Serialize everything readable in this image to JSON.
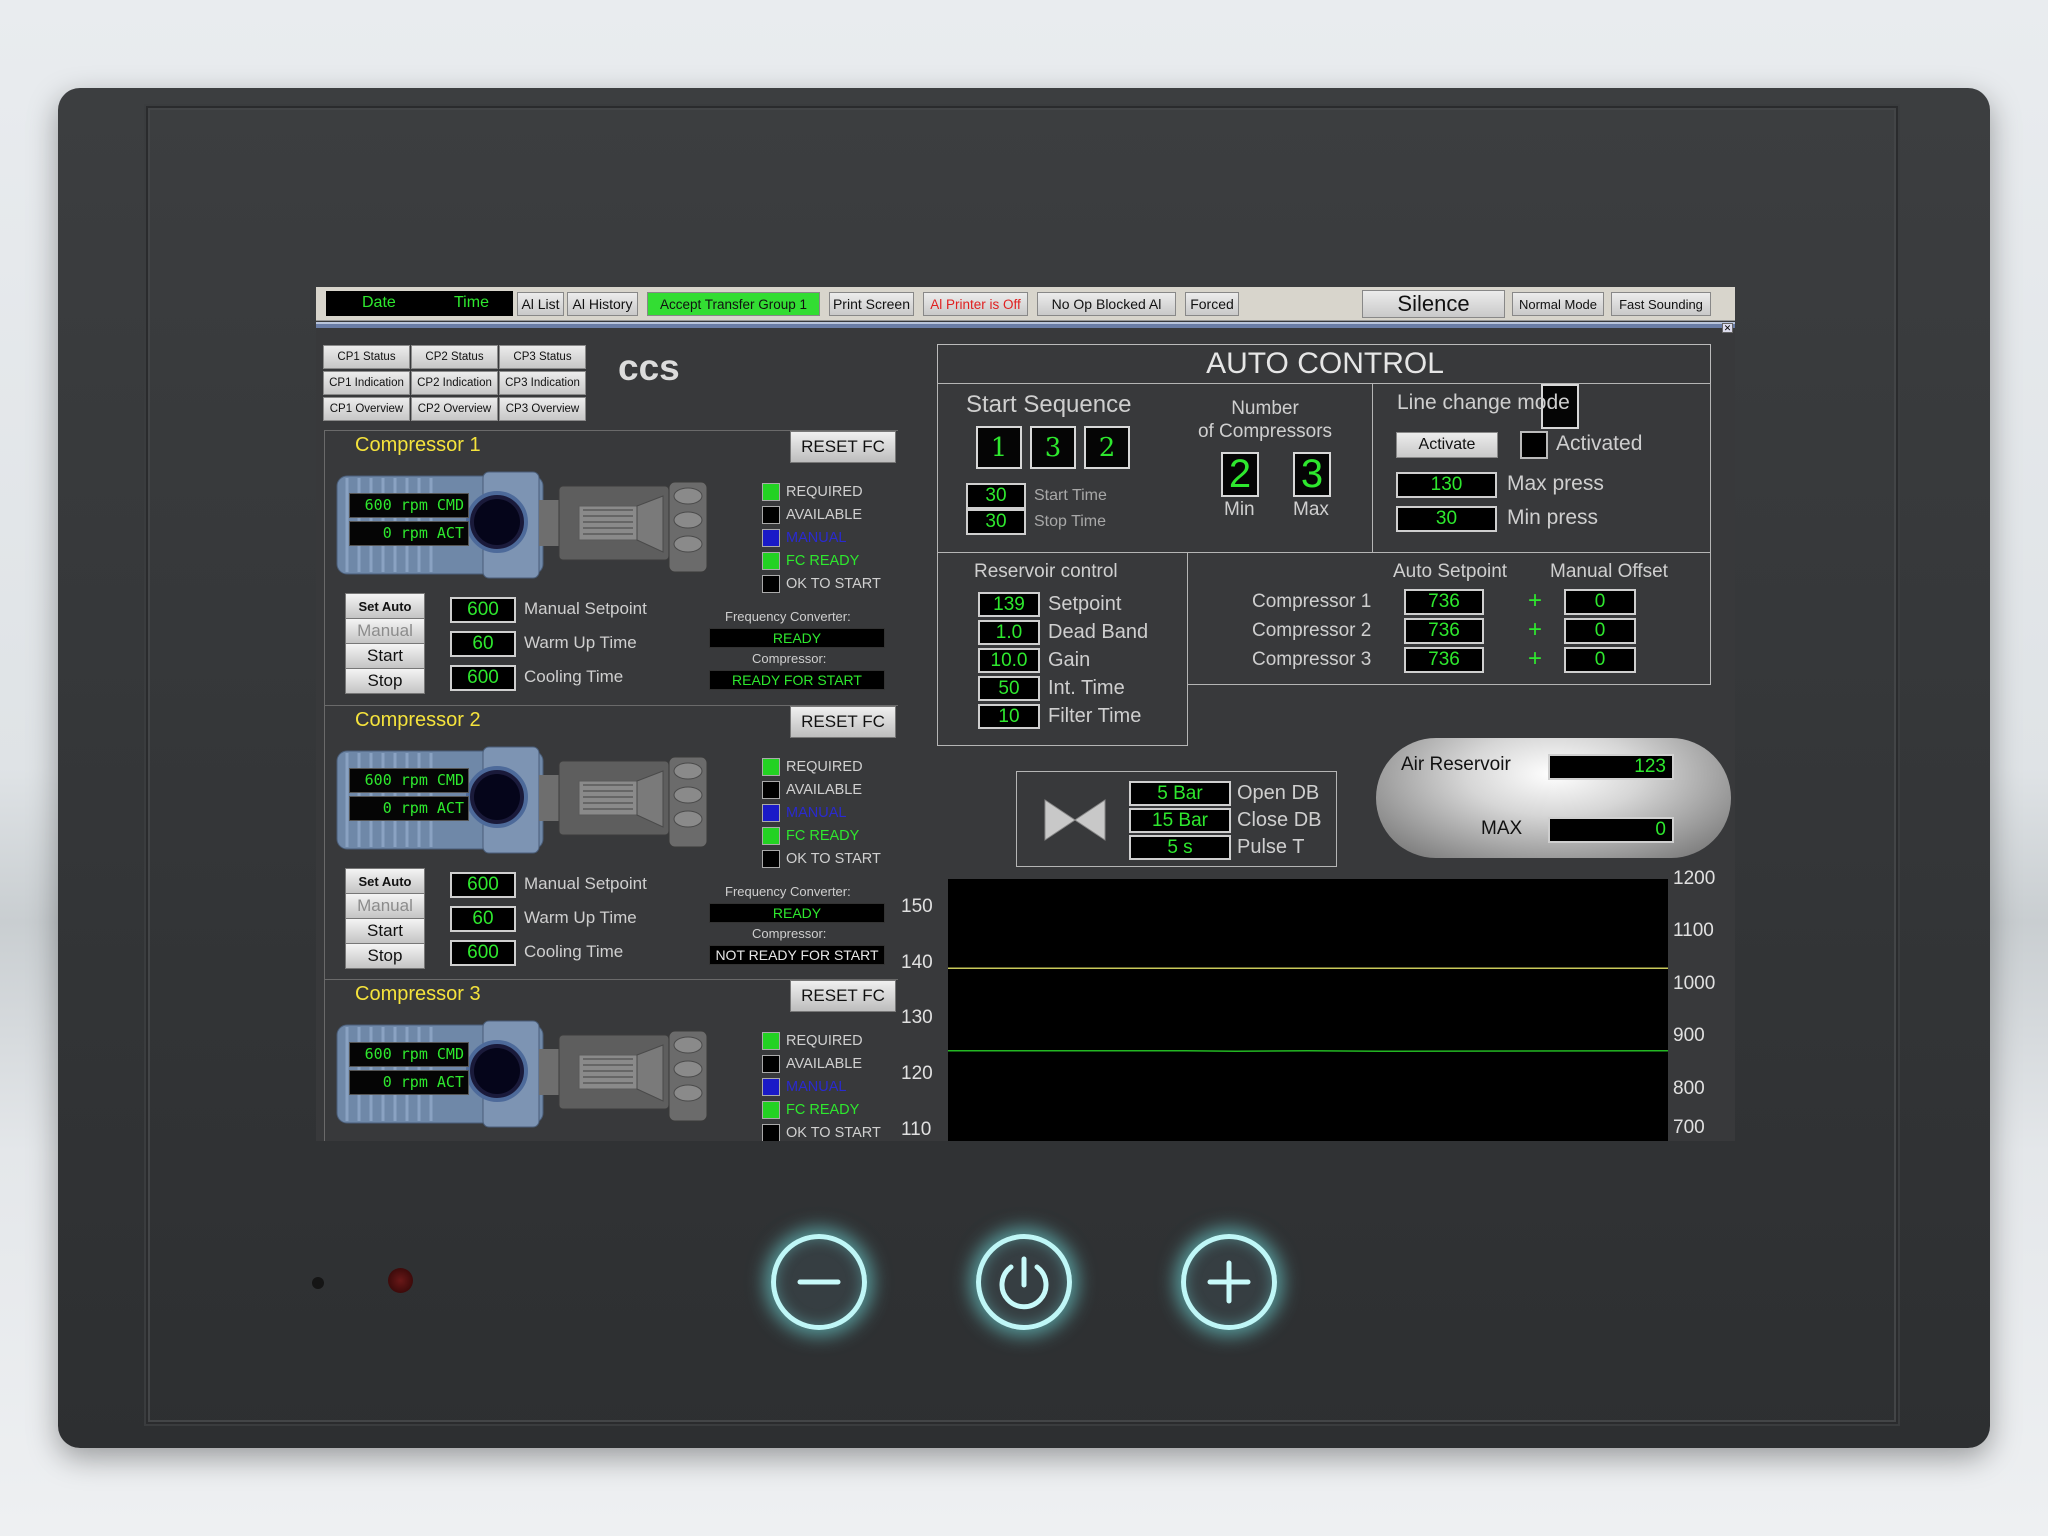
{
  "topbar": {
    "date_label": "Date",
    "time_label": "Time",
    "buttons": [
      {
        "label": "Al List"
      },
      {
        "label": "Al History"
      },
      {
        "label": "Accept Transfer Group 1",
        "bg": "#33dd33"
      },
      {
        "label": "Print Screen"
      },
      {
        "label": "Al Printer is Off",
        "color": "#e02020"
      },
      {
        "label": "No Op Blocked Al"
      },
      {
        "label": "Forced"
      }
    ],
    "silence_label": "Silence",
    "normal_mode_label": "Normal Mode",
    "fast_sounding_label": "Fast Sounding",
    "close_glyph": "✕"
  },
  "cp_buttons": [
    [
      "CP1 Status",
      "CP2 Status",
      "CP3 Status"
    ],
    [
      "CP1 Indication",
      "CP2 Indication",
      "CP3 Indication"
    ],
    [
      "CP1 Overview",
      "CP2 Overview",
      "CP3 Overview"
    ]
  ],
  "ccs_title": "ccs",
  "compressors": [
    {
      "title": "Compressor 1",
      "reset_label": "RESET FC",
      "rpm_cmd": "600 rpm CMD",
      "rpm_act": "0 rpm ACT",
      "status": [
        {
          "label": "REQUIRED",
          "state": "green",
          "color": "#d0d0d0"
        },
        {
          "label": "AVAILABLE",
          "state": "black",
          "color": "#d0d0d0"
        },
        {
          "label": "MANUAL",
          "state": "blue",
          "color": "#2a2ad0"
        },
        {
          "label": "FC READY",
          "state": "green",
          "color": "#2ee82e"
        },
        {
          "label": "OK TO START",
          "state": "black",
          "color": "#d0d0d0"
        }
      ],
      "buttons": {
        "set_auto": "Set Auto",
        "manual": "Manual",
        "start": "Start",
        "stop": "Stop"
      },
      "manual_setpoint": "600",
      "manual_setpoint_label": "Manual Setpoint",
      "warm_up": "60",
      "warm_up_label": "Warm Up Time",
      "cooling": "600",
      "cooling_label": "Cooling Time",
      "fc_label": "Frequency Converter:",
      "fc_status": "READY",
      "compressor_label": "Compressor:",
      "compressor_status": "READY FOR START",
      "compressor_status_color": "#2ee82e"
    },
    {
      "title": "Compressor 2",
      "reset_label": "RESET FC",
      "rpm_cmd": "600 rpm CMD",
      "rpm_act": "0 rpm ACT",
      "status": [
        {
          "label": "REQUIRED",
          "state": "green",
          "color": "#d0d0d0"
        },
        {
          "label": "AVAILABLE",
          "state": "black",
          "color": "#d0d0d0"
        },
        {
          "label": "MANUAL",
          "state": "blue",
          "color": "#2a2ad0"
        },
        {
          "label": "FC READY",
          "state": "green",
          "color": "#2ee82e"
        },
        {
          "label": "OK TO START",
          "state": "black",
          "color": "#d0d0d0"
        }
      ],
      "buttons": {
        "set_auto": "Set Auto",
        "manual": "Manual",
        "start": "Start",
        "stop": "Stop"
      },
      "manual_setpoint": "600",
      "manual_setpoint_label": "Manual Setpoint",
      "warm_up": "60",
      "warm_up_label": "Warm Up Time",
      "cooling": "600",
      "cooling_label": "Cooling Time",
      "fc_label": "Frequency Converter:",
      "fc_status": "READY",
      "compressor_label": "Compressor:",
      "compressor_status": "NOT READY FOR START",
      "compressor_status_color": "#e8e8e8"
    },
    {
      "title": "Compressor 3",
      "reset_label": "RESET FC",
      "rpm_cmd": "600 rpm CMD",
      "rpm_act": "0 rpm ACT",
      "status": [
        {
          "label": "REQUIRED",
          "state": "green",
          "color": "#d0d0d0"
        },
        {
          "label": "AVAILABLE",
          "state": "black",
          "color": "#d0d0d0"
        },
        {
          "label": "MANUAL",
          "state": "blue",
          "color": "#2a2ad0"
        },
        {
          "label": "FC READY",
          "state": "green",
          "color": "#2ee82e"
        },
        {
          "label": "OK TO START",
          "state": "black",
          "color": "#d0d0d0"
        }
      ]
    }
  ],
  "auto_control": {
    "title": "AUTO CONTROL",
    "start_sequence": {
      "title": "Start Sequence",
      "order": [
        "1",
        "3",
        "2"
      ],
      "start_time": "30",
      "start_time_label": "Start Time",
      "stop_time": "30",
      "stop_time_label": "Stop Time"
    },
    "num_compressors": {
      "title_line1": "Number",
      "title_line2": "of Compressors",
      "min": "2",
      "min_label": "Min",
      "max": "3",
      "max_label": "Max"
    },
    "line_change": {
      "title": "Line change mode",
      "activate_label": "Activate",
      "activated_label": "Activated",
      "max_press": "130",
      "max_press_label": "Max press",
      "min_press": "30",
      "min_press_label": "Min press"
    },
    "reservoir_control": {
      "title": "Reservoir control",
      "rows": [
        {
          "value": "139",
          "label": "Setpoint"
        },
        {
          "value": "1.0",
          "label": "Dead Band"
        },
        {
          "value": "10.0",
          "label": "Gain"
        },
        {
          "value": "50",
          "label": "Int. Time"
        },
        {
          "value": "10",
          "label": "Filter Time"
        }
      ]
    },
    "setpoints": {
      "auto_header": "Auto Setpoint",
      "manual_header": "Manual Offset",
      "plus_glyph": "+",
      "rows": [
        {
          "name": "Compressor 1",
          "auto": "736",
          "offset": "0"
        },
        {
          "name": "Compressor 2",
          "auto": "736",
          "offset": "0"
        },
        {
          "name": "Compressor 3",
          "auto": "736",
          "offset": "0"
        }
      ]
    }
  },
  "valve": {
    "open_db": "5 Bar",
    "open_db_label": "Open DB",
    "close_db": "15 Bar",
    "close_db_label": "Close DB",
    "pulse_t": "5 s",
    "pulse_t_label": "Pulse T"
  },
  "air_reservoir": {
    "label": "Air Reservoir",
    "value": "123",
    "max_label": "MAX",
    "max_value": "0"
  },
  "chart_data": {
    "type": "line",
    "left_axis": {
      "ticks": [
        "150",
        "140",
        "130",
        "120",
        "110"
      ],
      "ylim": [
        108,
        155
      ]
    },
    "right_axis": {
      "ticks": [
        "1200",
        "1100",
        "1000",
        "900",
        "800",
        "700"
      ],
      "ylim": [
        700,
        1200
      ]
    },
    "series": [
      {
        "color": "#c8c85a",
        "axis": "left",
        "x": [
          0,
          1
        ],
        "y": [
          139,
          139
        ]
      },
      {
        "color": "#23b823",
        "axis": "left",
        "x": [
          0,
          0.33,
          0.4,
          0.5,
          0.6,
          1
        ],
        "y": [
          124.2,
          124.2,
          124.1,
          124.2,
          124.1,
          124.2
        ]
      }
    ]
  },
  "hardware": {
    "minus_glyph": "−",
    "plus_glyph": "+"
  }
}
